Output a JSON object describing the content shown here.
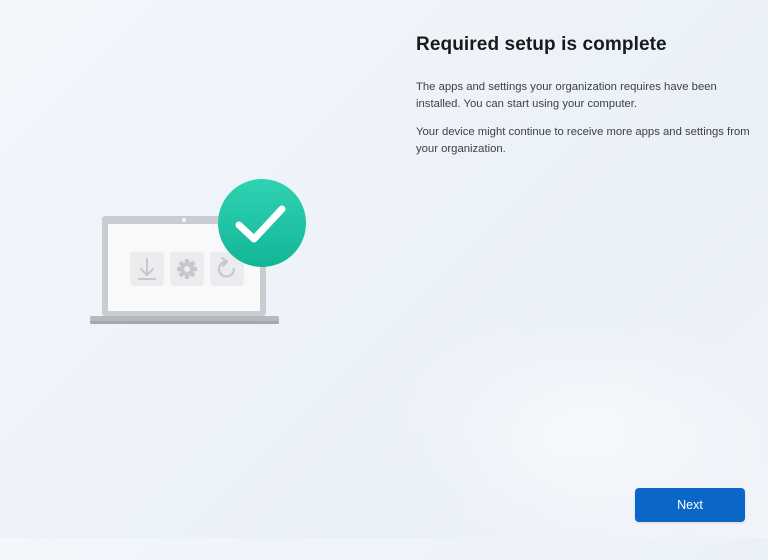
{
  "header": {
    "title": "Required setup is complete"
  },
  "main": {
    "paragraphs": [
      "The apps and settings your organization requires have been installed. You can start using your computer.",
      "Your device might continue to receive more apps and settings from your organization."
    ]
  },
  "illustration": {
    "icons": [
      "laptop-icon",
      "download-icon",
      "gear-icon",
      "refresh-icon",
      "checkmark-badge-icon"
    ]
  },
  "footer": {
    "next_label": "Next"
  },
  "colors": {
    "accent": "#0a67c7",
    "success": "#1fc4a4",
    "background": "#f0f4fa"
  }
}
